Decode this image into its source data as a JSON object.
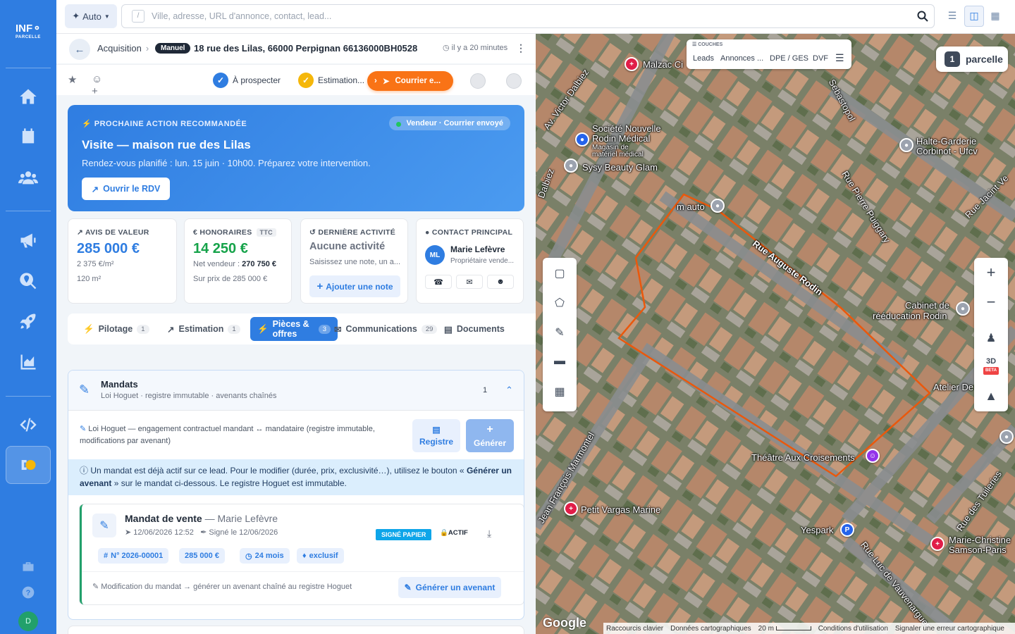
{
  "logo": {
    "line1": "INF",
    "line2": "PARCELLE"
  },
  "topbar": {
    "mode_label": "Auto",
    "search_placeholder": "Ville, adresse, URL d'annonce, contact, lead...",
    "search_shortcut": "/"
  },
  "header": {
    "crumb": "Acquisition",
    "badge": "Manuel",
    "address": "18 rue des Lilas, 66000 Perpignan 66136000BH0528",
    "time": "il y a 20 minutes"
  },
  "pipeline": {
    "steps": [
      {
        "label": "À prospecter",
        "color": "#2f7de1"
      },
      {
        "label": "Estimation...",
        "color": "#f5b70a"
      },
      {
        "label": "Courrier e...",
        "color": "#f97316"
      }
    ]
  },
  "reco": {
    "label": "PROCHAINE ACTION RECOMMANDÉE",
    "pill": "Vendeur · Courrier envoyé",
    "title": "Visite — maison rue des Lilas",
    "subtitle": "Rendez-vous planifié : lun. 15 juin · 10h00. Préparez votre intervention.",
    "button": "Ouvrir le RDV"
  },
  "kpis": {
    "valeur": {
      "label": "AVIS DE VALEUR",
      "value": "285 000 €",
      "per_m2": "2 375 €/m²",
      "surface": "120 m²"
    },
    "honoraires": {
      "label": "HONORAIRES",
      "tag": "TTC",
      "value": "14 250 €",
      "net_label": "Net vendeur : ",
      "net_value": "270 750 €",
      "sur": "Sur prix de 285 000 €"
    },
    "activite": {
      "label": "DERNIÈRE ACTIVITÉ",
      "value": "Aucune activité",
      "hint": "Saisissez une note, un a...",
      "button": "Ajouter une note"
    },
    "contact": {
      "label": "CONTACT PRINCIPAL",
      "initials": "ML",
      "name": "Marie Lefèvre",
      "role": "Propriétaire vende..."
    }
  },
  "tabs": [
    {
      "label": "Pilotage",
      "count": "1"
    },
    {
      "label": "Estimation",
      "count": "1"
    },
    {
      "label": "Pièces & offres",
      "count": "3"
    },
    {
      "label": "Communications",
      "count": "29"
    },
    {
      "label": "Documents",
      "count": ""
    }
  ],
  "mandats": {
    "title": "Mandats",
    "subtitle": "Loi Hoguet · registre immutable · avenants chaînés",
    "count": "1",
    "loi_text": "Loi Hoguet — engagement contractuel mandant ↔ mandataire (registre immutable, modifications par avenant)",
    "btn_registre": "Registre",
    "btn_generer": "Générer",
    "info_pre": "Un mandat est déjà actif sur ce lead. Pour le modifier (durée, prix, exclusivité…), utilisez le bouton « ",
    "info_bold": "Générer un avenant",
    "info_post": " » sur le mandat ci-dessous. Le registre Hoguet est immutable.",
    "card": {
      "title": "Mandat de vente",
      "owner": "— Marie Lefèvre",
      "date": "12/06/2026 12:52",
      "signed": "Signé le 12/06/2026",
      "badge_signe": "SIGNÉ PAPIER",
      "badge_actif": "ACTIF",
      "chips": [
        "N° 2026-00001",
        "285 000 €",
        "24 mois",
        "exclusif"
      ],
      "modif": "Modification du mandat → générer un avenant chaîné au registre Hoguet",
      "btn_avenant": "Générer un avenant"
    }
  },
  "map": {
    "couches_title": "COUCHES",
    "layers": [
      "Leads",
      "Annonces ...",
      "DPE / GES",
      "DVF"
    ],
    "parcelle_count": "1",
    "parcelle_label": "parcelle",
    "labels": [
      "Malzac Ci",
      "Av. Victor Dalbiez",
      "Dalbiez",
      "Société Nouvelle",
      "Rodin Médical",
      "Magasin de",
      "matériel médical",
      "Sysy Beauty Glam",
      "m auto",
      "Rue Auguste Rodin",
      "Rue Pierre Puiggary",
      "Halte-Garderie",
      "Corbinot - Ufcv",
      "Sebastopol",
      "Rue Jacint Ve",
      "Cabinet de",
      "rééducation Rodin",
      "Atelier De",
      "Théâtre Aux Croisements",
      "Jean François Marmontel",
      "Petit Vargas Marine",
      "Yespark",
      "Rue Luc de Vauvenargues",
      "Rue des Tuileries",
      "Marie-Christine",
      "Samson-Paris"
    ],
    "google": "Google",
    "footer": [
      "Raccourcis clavier",
      "Données cartographiques",
      "20 m",
      "Conditions d'utilisation",
      "Signaler une erreur cartographique"
    ],
    "zoom_3d": "3D",
    "beta": "BETA"
  }
}
